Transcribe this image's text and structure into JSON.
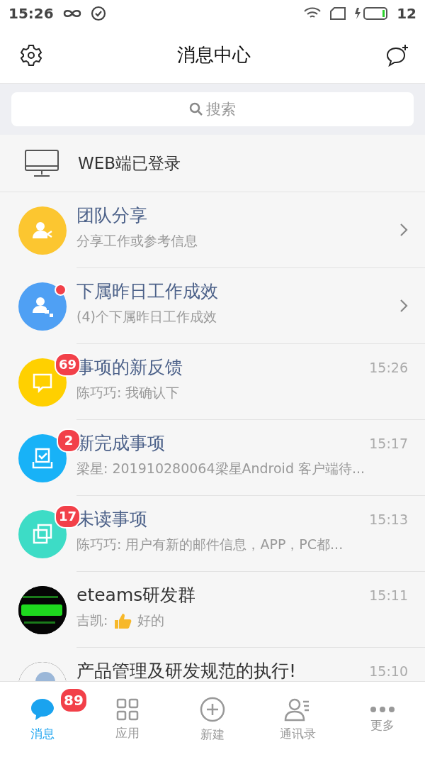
{
  "status_bar": {
    "time": "15:26",
    "battery": "12"
  },
  "header": {
    "title": "消息中心"
  },
  "search": {
    "placeholder": "搜索"
  },
  "web_login": {
    "label": "WEB端已登录"
  },
  "messages": [
    {
      "kind": "share",
      "color": "#fcc630",
      "title": "团队分享",
      "preview": "分享工作或参考信息",
      "chevron": true
    },
    {
      "kind": "subordinate",
      "color": "#4fa0f4",
      "title": "下属昨日工作成效",
      "preview": "(4)个下属昨日工作成效",
      "chevron": true,
      "dot": true
    },
    {
      "kind": "feedback",
      "color": "#ffd000",
      "title": "事项的新反馈",
      "preview": "陈巧巧: 我确认下",
      "time": "15:26",
      "badge": "69"
    },
    {
      "kind": "done",
      "color": "#18b2f7",
      "title": "新完成事项",
      "preview": "梁星: 201910280064梁星Android 客户端待...",
      "time": "15:17",
      "badge": "2"
    },
    {
      "kind": "unread",
      "color": "#3ddcc6",
      "title": "未读事项",
      "preview": "陈巧巧: 用户有新的邮件信息，APP，PC都...",
      "time": "15:13",
      "badge": "17"
    },
    {
      "kind": "picture",
      "title": "eteams研发群",
      "preview": "吉凯:",
      "reaction": true,
      "preview_after": "好的",
      "time": "15:11",
      "plain": true
    },
    {
      "kind": "picture",
      "title": "产品管理及研发规范的执行!",
      "time": "15:10",
      "plain": true
    }
  ],
  "tabs": [
    {
      "kind": "chat",
      "label": "消息",
      "selected": true,
      "badge": "89"
    },
    {
      "kind": "apps",
      "label": "应用",
      "selected": false
    },
    {
      "kind": "add",
      "label": "新建",
      "selected": false
    },
    {
      "kind": "contacts",
      "label": "通讯录",
      "selected": false
    },
    {
      "kind": "more",
      "label": "更多",
      "selected": false
    }
  ]
}
